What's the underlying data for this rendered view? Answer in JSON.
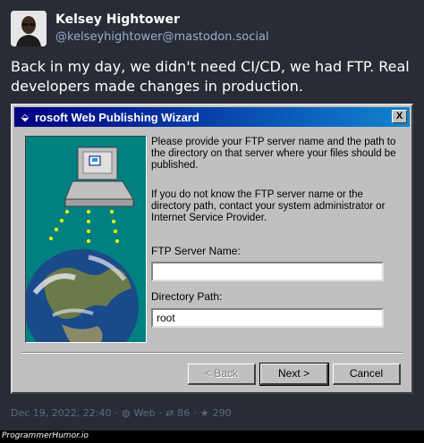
{
  "post": {
    "author_name": "Kelsey Hightower",
    "author_handle": "@kelseyhightower@mastodon.social",
    "text": "Back in my day, we didn't need CI/CD, we had FTP. Real developers made changes in production.",
    "date": "Dec 19, 2022, 22:40",
    "visibility_icon": "globe-icon",
    "visibility": "Web",
    "boost_icon": "retweet-icon",
    "boosts": "86",
    "favourite_icon": "star-icon",
    "favourites": "290"
  },
  "dialog": {
    "title": "rosoft Web Publishing Wizard",
    "instruction_1": "Please provide your FTP server name and the path to the directory on that server where your files should be published.",
    "instruction_2": "If you do not know the FTP server name or the directory path, contact your system administrator or Internet Service Provider.",
    "ftp_label": "FTP Server Name:",
    "ftp_value": "",
    "dir_label": "Directory Path:",
    "dir_value": "root",
    "back_label": "< Back",
    "next_label": "Next >",
    "cancel_label": "Cancel",
    "close_label": "X"
  },
  "watermark": "ProgrammerHumor.io",
  "colors": {
    "background": "#282c37",
    "handle": "#9baec8",
    "meta": "#606984",
    "titlebar": "#000080",
    "dialog": "#c0c0c0",
    "teal": "#008080"
  }
}
